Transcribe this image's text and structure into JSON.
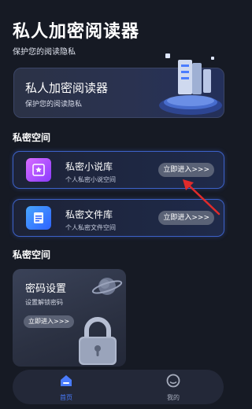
{
  "header": {
    "title": "私人加密阅读器",
    "subtitle": "保护您的阅读隐私"
  },
  "hero": {
    "title": "私人加密阅读器",
    "subtitle": "保护您的阅读隐私"
  },
  "section_private_space_1": {
    "title": "私密空间"
  },
  "entries": [
    {
      "title": "私密小说库",
      "subtitle": "个人私密小说空间",
      "button": "立即进入>>>",
      "icon": "novel-library-icon"
    },
    {
      "title": "私密文件库",
      "subtitle": "个人私密文件空间",
      "button": "立即进入>>>",
      "icon": "file-library-icon"
    }
  ],
  "section_private_space_2": {
    "title": "私密空间"
  },
  "password_card": {
    "title": "密码设置",
    "subtitle": "设置解锁密码",
    "button": "立即进入>>>"
  },
  "bottom_nav": {
    "items": [
      {
        "label": "首页",
        "icon": "home-icon",
        "active": true
      },
      {
        "label": "我的",
        "icon": "profile-icon",
        "active": false
      }
    ]
  },
  "colors": {
    "background": "#161a24",
    "accent_blue": "#4a7cff",
    "card_border": "#3d62c9",
    "annotation_red": "#e02b2b"
  }
}
